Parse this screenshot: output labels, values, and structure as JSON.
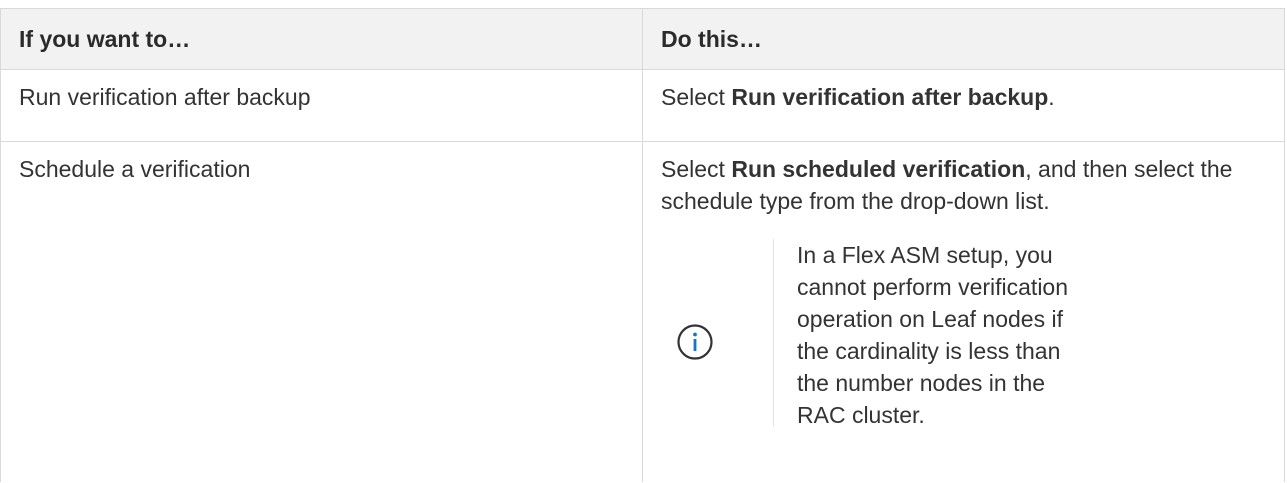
{
  "table": {
    "headers": [
      "If you want to…",
      "Do this…"
    ],
    "rows": [
      {
        "want": "Run verification after backup",
        "do_prefix": "Select ",
        "do_bold": "Run verification after backup",
        "do_suffix": "."
      },
      {
        "want": "Schedule a verification",
        "do_prefix": "Select ",
        "do_bold": "Run scheduled verification",
        "do_suffix": ", and then select the schedule type from the drop-down list.",
        "note": "In a Flex ASM setup, you cannot perform verification operation on Leaf nodes if the cardinality is less than the number nodes in the RAC cluster."
      }
    ]
  },
  "icons": {
    "note_icon": "info-circle-icon"
  },
  "colors": {
    "header_bg": "#f2f2f2",
    "border": "#d9d9d9",
    "text": "#333333"
  }
}
